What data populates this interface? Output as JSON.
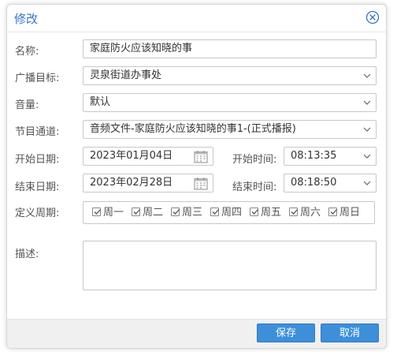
{
  "dialog": {
    "title": "修改"
  },
  "form": {
    "name": {
      "label": "名称:",
      "value": "家庭防火应该知晓的事"
    },
    "target": {
      "label": "广播目标:",
      "value": "灵泉街道办事处"
    },
    "volume": {
      "label": "音量:",
      "value": "默认"
    },
    "channel": {
      "label": "节目通道:",
      "value": "音频文件-家庭防火应该知晓的事1-(正式播报)"
    },
    "start_date": {
      "label": "开始日期:",
      "value": "2023年01月04日"
    },
    "start_time": {
      "label": "开始时间:",
      "value": "08:13:35"
    },
    "end_date": {
      "label": "结束日期:",
      "value": "2023年02月28日"
    },
    "end_time": {
      "label": "结束时间:",
      "value": "08:18:50"
    },
    "period": {
      "label": "定义周期:",
      "days": [
        {
          "label": "周一",
          "checked": true
        },
        {
          "label": "周二",
          "checked": true
        },
        {
          "label": "周三",
          "checked": true
        },
        {
          "label": "周四",
          "checked": true
        },
        {
          "label": "周五",
          "checked": true
        },
        {
          "label": "周六",
          "checked": true
        },
        {
          "label": "周日",
          "checked": true
        }
      ]
    },
    "description": {
      "label": "描述:",
      "value": ""
    }
  },
  "footer": {
    "save_label": "保存",
    "cancel_label": "取消"
  },
  "colors": {
    "accent": "#3574bf",
    "button": "#3d8fd9",
    "footer_bg": "#f0f0f0"
  }
}
